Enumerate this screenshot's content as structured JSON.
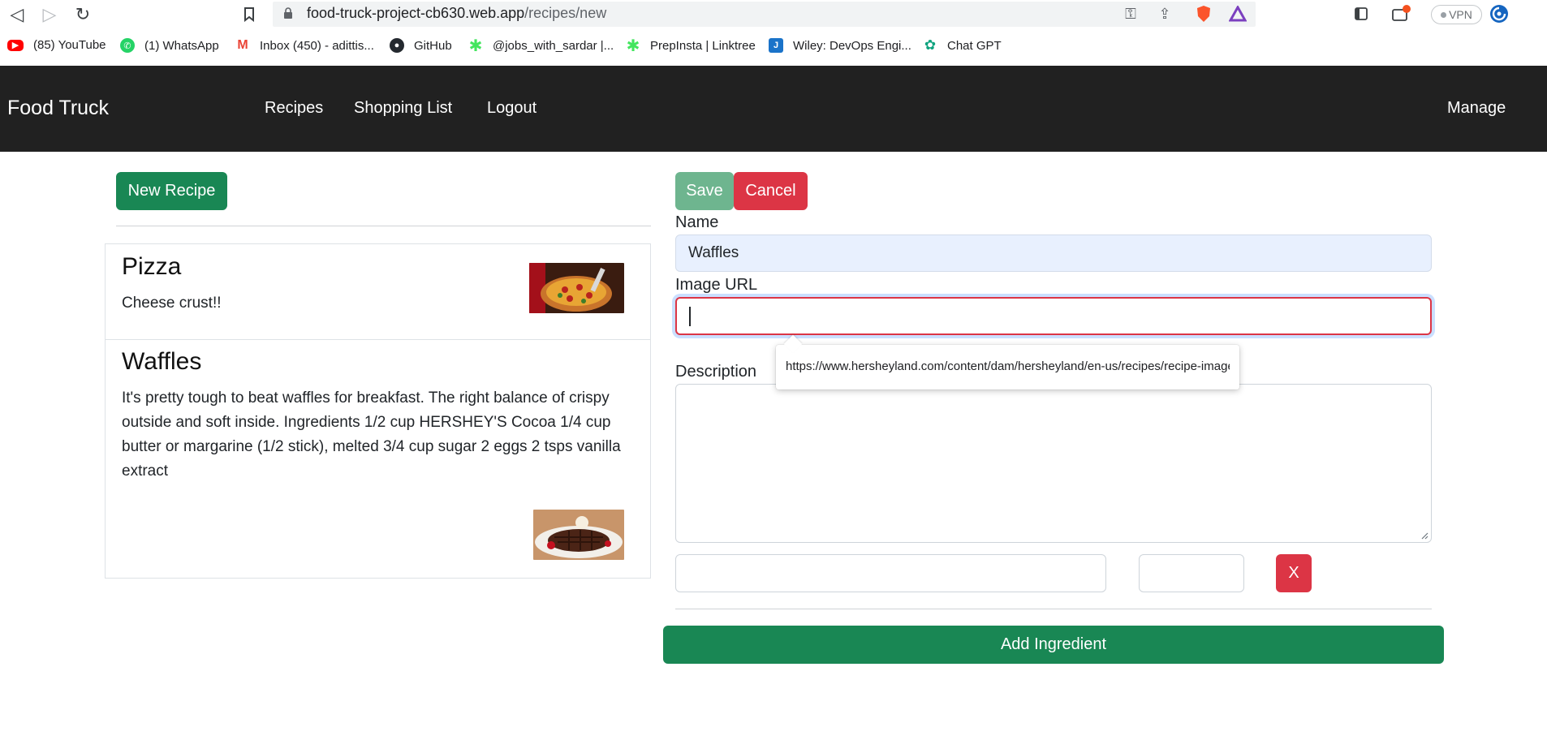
{
  "browser": {
    "url_host": "food-truck-project-cb630.web.app",
    "url_path": "/recipes/new",
    "vpn_label": "VPN",
    "bookmarks": [
      {
        "label": "(85) YouTube",
        "icon": "youtube-icon",
        "color": "#ff0000"
      },
      {
        "label": "(1) WhatsApp",
        "icon": "whatsapp-icon",
        "color": "#25d366"
      },
      {
        "label": "Inbox (450) - adittis...",
        "icon": "gmail-icon",
        "color": "#ea4335"
      },
      {
        "label": "GitHub",
        "icon": "github-icon",
        "color": "#24292f"
      },
      {
        "label": "@jobs_with_sardar |...",
        "icon": "linktree-icon",
        "color": "#43e55e"
      },
      {
        "label": "PrepInsta | Linktree",
        "icon": "linktree-icon",
        "color": "#43e55e"
      },
      {
        "label": "Wiley: DevOps Engi...",
        "icon": "wiley-icon",
        "color": "#1a73c9"
      },
      {
        "label": "Chat GPT",
        "icon": "chatgpt-icon",
        "color": "#10a37f"
      }
    ]
  },
  "navbar": {
    "brand": "Food Truck",
    "links": [
      "Recipes",
      "Shopping List",
      "Logout"
    ],
    "manage": "Manage"
  },
  "recipes": {
    "new_button": "New Recipe",
    "items": [
      {
        "name": "Pizza",
        "description": "Cheese crust!!"
      },
      {
        "name": "Waffles",
        "description": "It's pretty tough to beat waffles for breakfast. The right balance of crispy outside and soft inside. Ingredients 1/2 cup HERSHEY'S Cocoa 1/4 cup butter or margarine (1/2 stick), melted 3/4 cup sugar 2 eggs 2 tsps vanilla extract"
      }
    ]
  },
  "form": {
    "save": "Save",
    "cancel": "Cancel",
    "name_label": "Name",
    "name_value": "Waffles",
    "image_label": "Image URL",
    "image_value": "",
    "description_label": "Description",
    "remove_ingredient": "X",
    "add_ingredient": "Add Ingredient",
    "autofill_suggestion": "https://www.hersheyland.com/content/dam/hersheyland/en-us/recipes/recipe-images/"
  },
  "colors": {
    "navbar_bg": "#212121",
    "primary_green": "#198754",
    "danger_red": "#dc3545"
  }
}
